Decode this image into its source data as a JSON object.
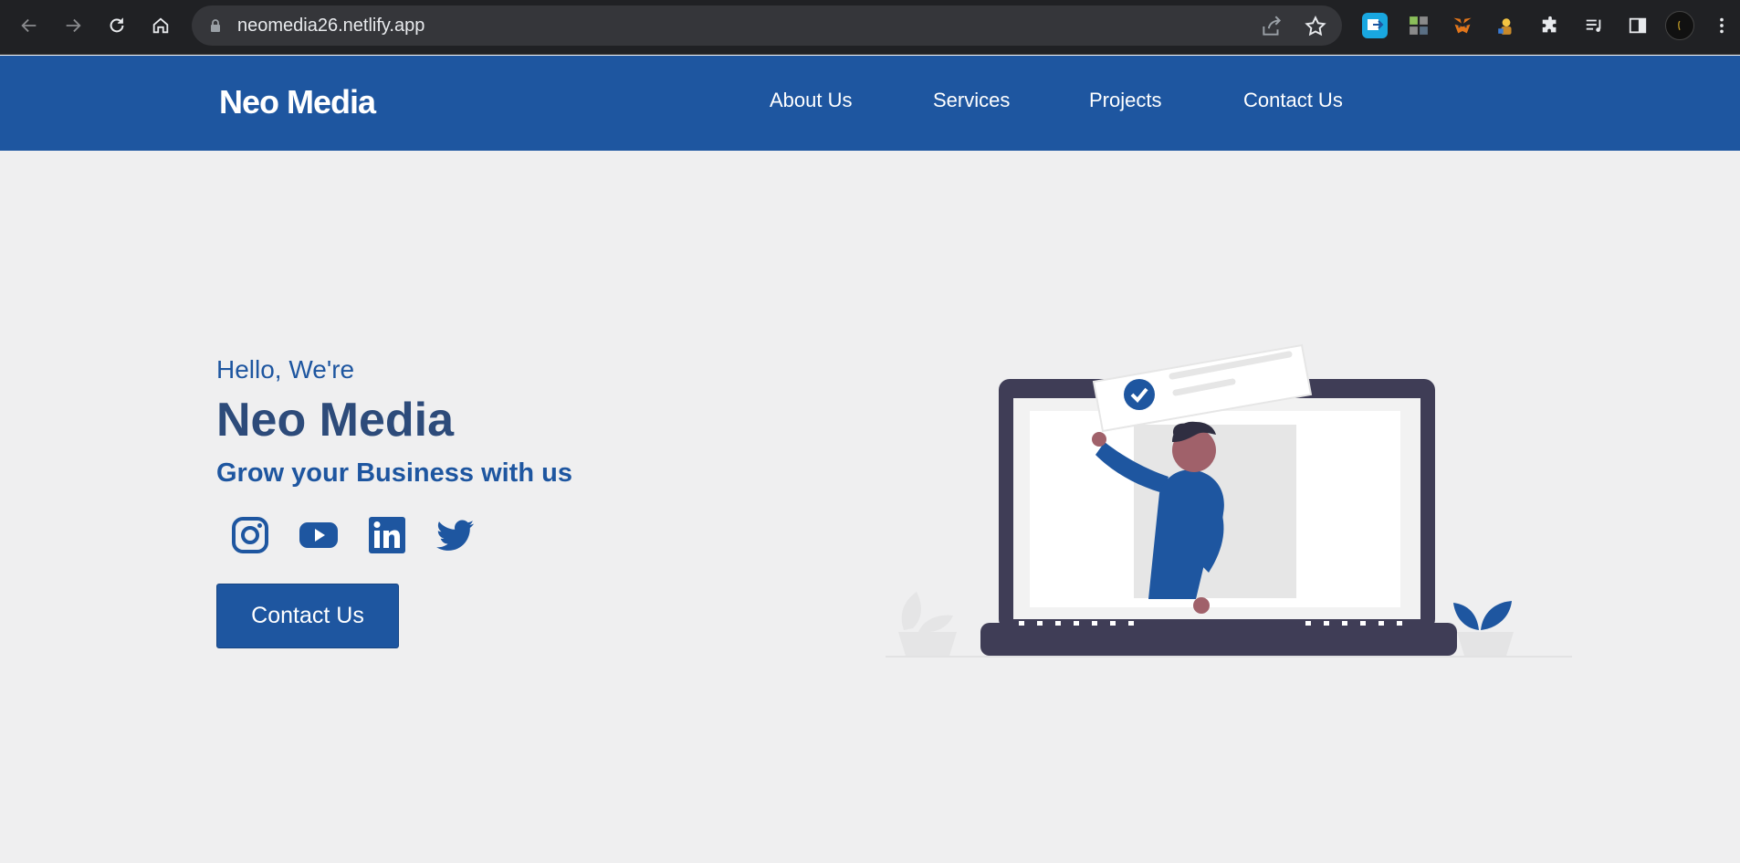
{
  "browser": {
    "url": "neomedia26.netlify.app"
  },
  "header": {
    "logo": "Neo Media",
    "nav": [
      {
        "label": "About Us"
      },
      {
        "label": "Services"
      },
      {
        "label": "Projects"
      },
      {
        "label": "Contact Us"
      }
    ]
  },
  "hero": {
    "greeting": "Hello, We're",
    "title": "Neo Media",
    "tagline": "Grow your Business with us",
    "cta_label": "Contact Us",
    "social": [
      "instagram-icon",
      "youtube-icon",
      "linkedin-icon",
      "twitter-icon"
    ]
  },
  "colors": {
    "brand": "#1e56a0",
    "background": "#efeff0",
    "heading": "#2d4b7a",
    "chrome": "#202124"
  }
}
